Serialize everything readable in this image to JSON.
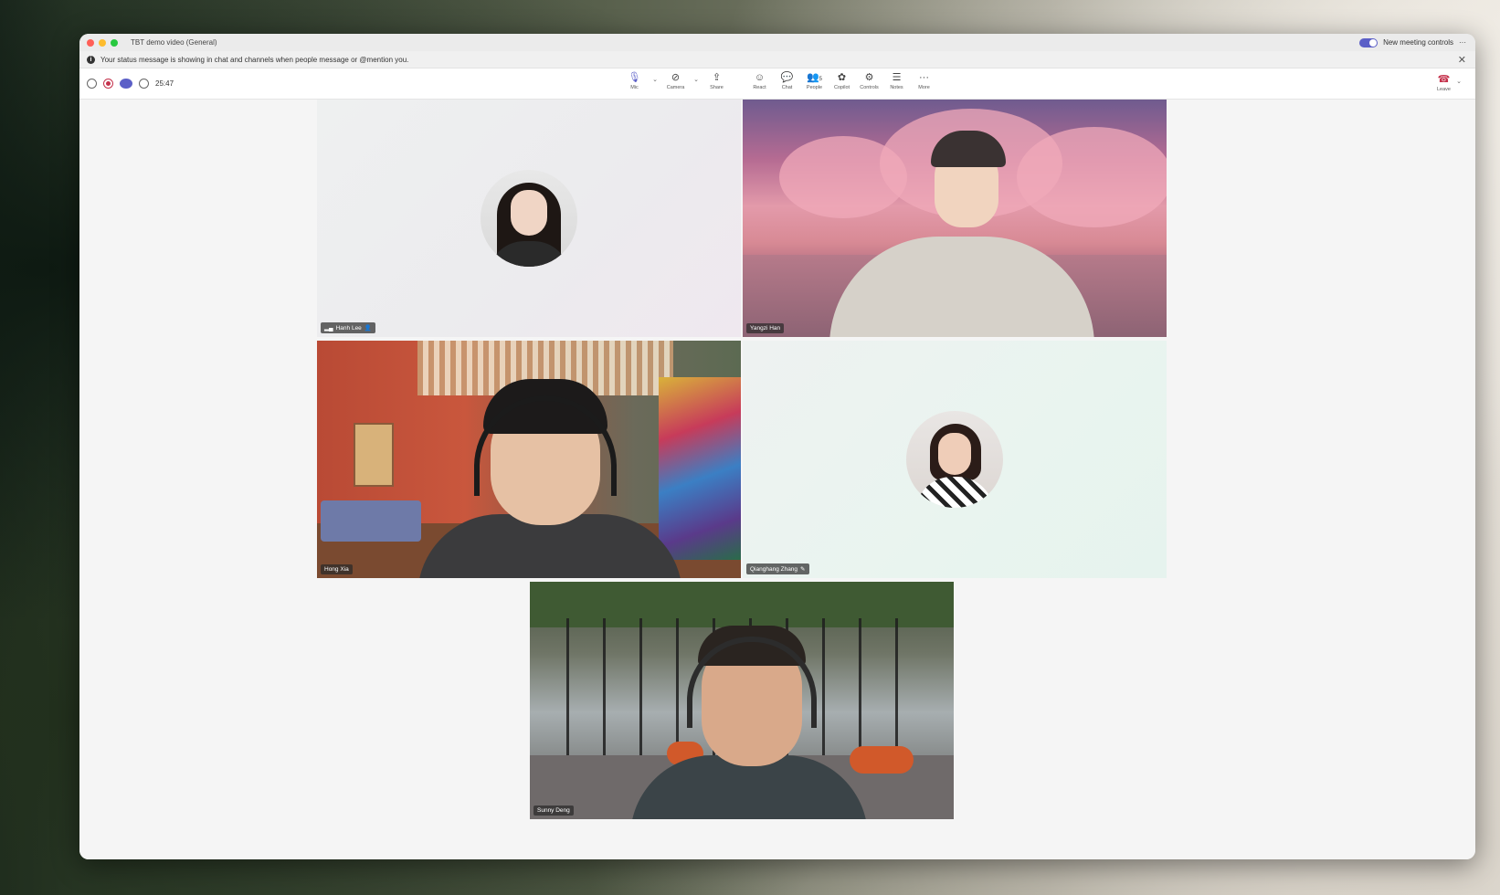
{
  "window": {
    "title": "TBT demo video (General)",
    "new_meeting_controls_label": "New meeting controls",
    "more_glyph": "···"
  },
  "banner": {
    "message": "Your status message is showing in chat and channels when people message or @mention you.",
    "info_glyph": "i",
    "close_glyph": "✕"
  },
  "toolbar": {
    "timer": "25:47",
    "buttons": [
      {
        "label": "Mic",
        "icon": "mic-icon",
        "glyph": "🎙"
      },
      {
        "label": "Camera",
        "icon": "camera-off-icon",
        "glyph": "⊘"
      },
      {
        "label": "Share",
        "icon": "share-icon",
        "glyph": "⇪"
      },
      {
        "label": "React",
        "icon": "react-icon",
        "glyph": "☺"
      },
      {
        "label": "Chat",
        "icon": "chat-icon",
        "glyph": "💬"
      },
      {
        "label": "People",
        "icon": "people-icon",
        "glyph": "👥",
        "badge": "5"
      },
      {
        "label": "Copilot",
        "icon": "copilot-icon",
        "glyph": "✿"
      },
      {
        "label": "Controls",
        "icon": "controls-icon",
        "glyph": "⚙"
      },
      {
        "label": "Notes",
        "icon": "notes-icon",
        "glyph": "☰"
      },
      {
        "label": "More",
        "icon": "more-icon",
        "glyph": "···"
      }
    ],
    "leave_label": "Leave",
    "leave_glyph": "☎",
    "caret_glyph": "⌄"
  },
  "participants": [
    {
      "name": "Hanh Lee",
      "signal_glyph": "▂▄",
      "status_glyph": "👤"
    },
    {
      "name": "Yangzi Han"
    },
    {
      "name": "Hong Xia"
    },
    {
      "name": "Qianghang Zhang",
      "status_glyph": "✎"
    },
    {
      "name": "Sunny Deng"
    }
  ],
  "colors": {
    "accent": "#5b5fc7",
    "leave": "#c4314b"
  }
}
